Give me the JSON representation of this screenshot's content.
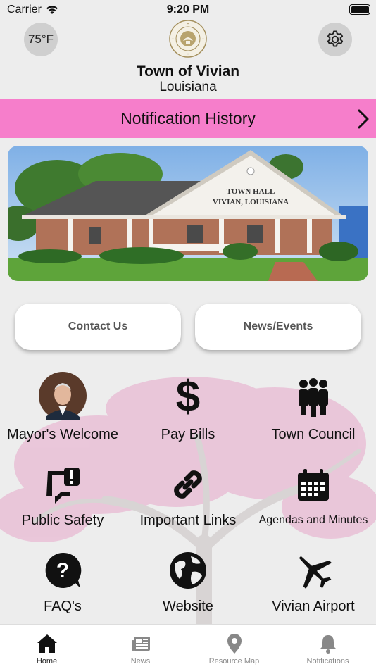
{
  "status_bar": {
    "carrier": "Carrier",
    "time": "9:20 PM"
  },
  "header": {
    "temperature": "75°F",
    "town_name": "Town of Vivian",
    "state_name": "Louisiana",
    "seal_text": "TOWN OF VIVIAN · STATE OF LOUISIANA"
  },
  "notification_banner": {
    "label": "Notification History",
    "color": "#f67ecb"
  },
  "hero_photo": {
    "sign_line1": "TOWN HALL",
    "sign_line2": "VIVIAN, LOUISIANA"
  },
  "buttons": {
    "contact": "Contact Us",
    "news_events": "News/Events"
  },
  "grid": {
    "mayor": "Mayor's Welcome",
    "pay_bills": "Pay Bills",
    "town_council": "Town Council",
    "public_safety": "Public Safety",
    "important_links": "Important Links",
    "agendas": "Agendas and Minutes",
    "faqs": "FAQ's",
    "website": "Website",
    "airport": "Vivian Airport"
  },
  "tabs": [
    {
      "label": "Home",
      "icon": "home-icon"
    },
    {
      "label": "News",
      "icon": "newspaper-icon"
    },
    {
      "label": "Resource Map",
      "icon": "map-pin-icon"
    },
    {
      "label": "Notifications",
      "icon": "bell-icon"
    }
  ]
}
